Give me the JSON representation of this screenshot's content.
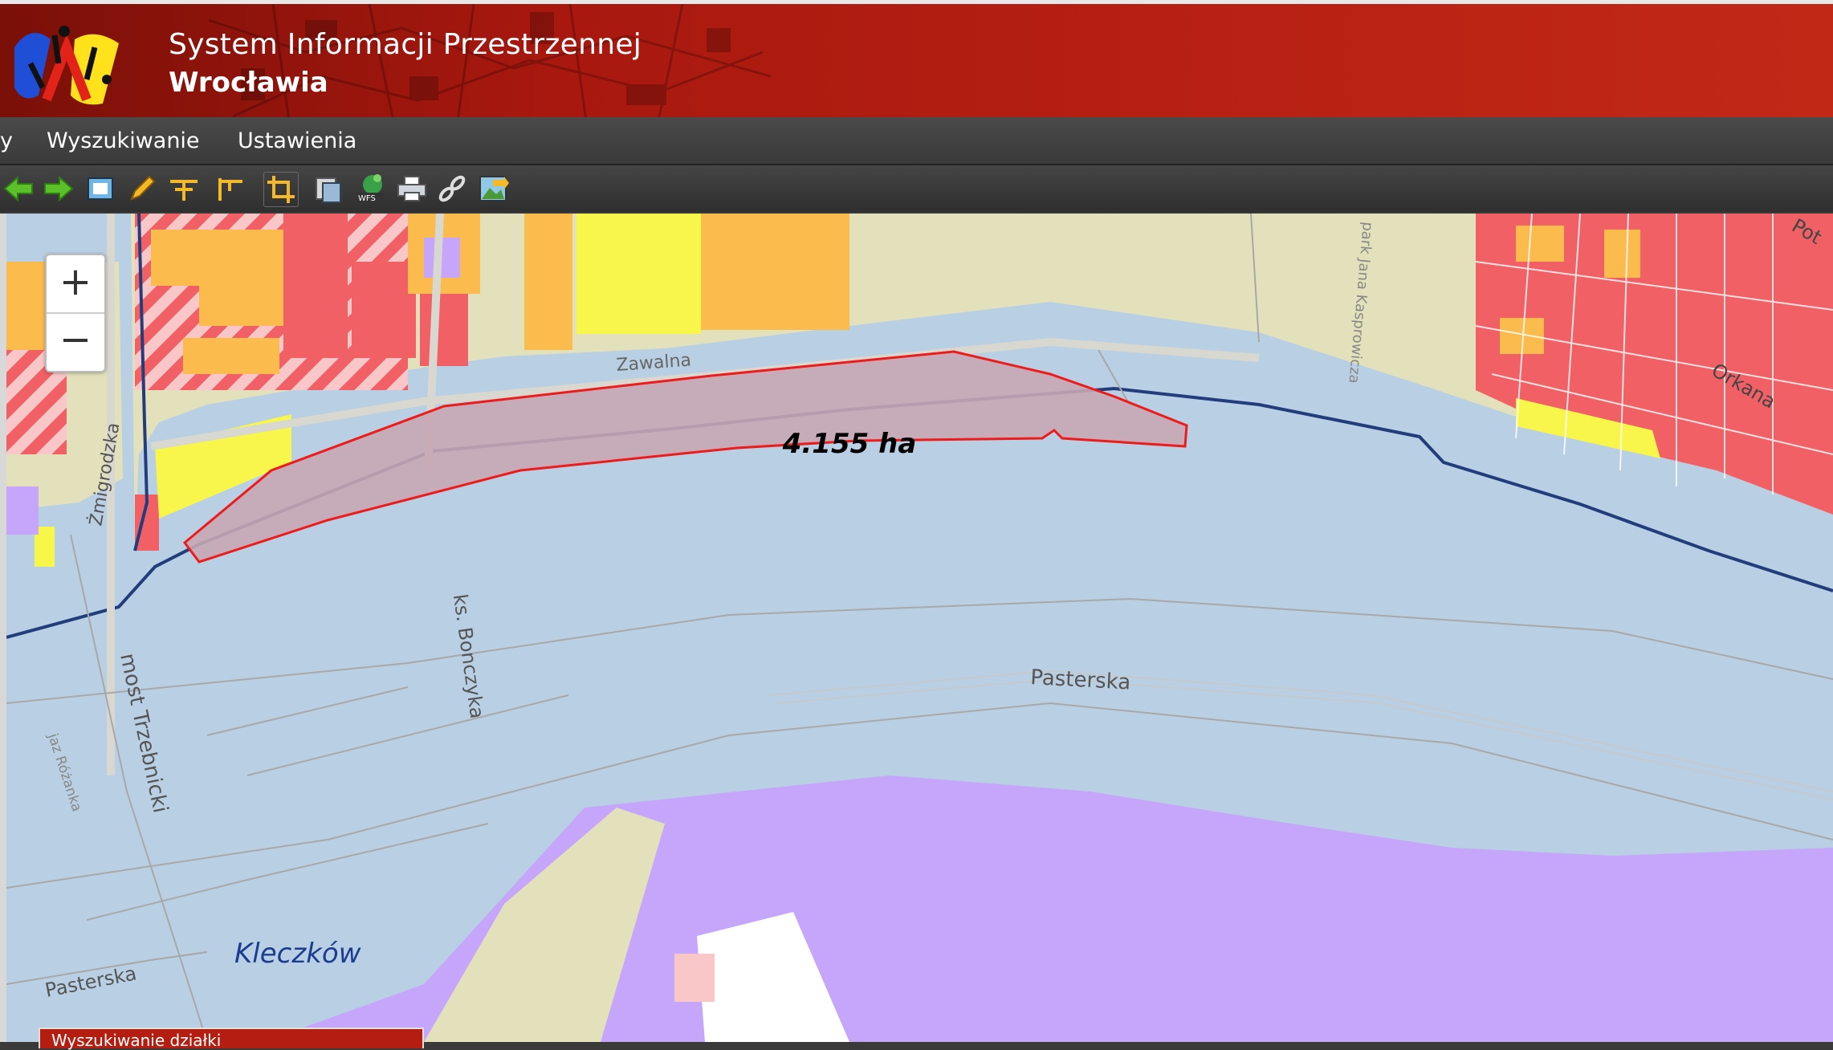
{
  "header": {
    "title_line1": "System Informacji Przestrzennej",
    "title_line2": "Wrocławia"
  },
  "menu": {
    "items": [
      {
        "label": "y"
      },
      {
        "label": "Wyszukiwanie"
      },
      {
        "label": "Ustawienia"
      }
    ]
  },
  "toolbar": {
    "tools": [
      "back-arrow-icon",
      "forward-arrow-icon",
      "full-extent-icon",
      "draw-pencil-icon",
      "measure-distance-icon",
      "measure-area-icon",
      "crop-icon",
      "layers-icon",
      "wfs-icon",
      "print-icon",
      "link-icon",
      "export-image-icon"
    ]
  },
  "map": {
    "zoom_in_label": "+",
    "zoom_out_label": "−",
    "area_label": "4.155 ha",
    "labels": {
      "street_zawalna": "Zawalna",
      "street_bonczyka": "ks. Bonczyka",
      "street_zmigrodzka": "Żmigrodzka",
      "bridge_trzebnicki": "most Trzebnicki",
      "street_pasterska_center": "Pasterska",
      "street_pasterska_left": "Pasterska",
      "park_kasprowicza": "park Jana Kasprowicza",
      "street_orkana": "Orkana",
      "street_pot": "Pot",
      "weir_rozanka": "jaz Różanka",
      "district_kleczkow": "Kleczków"
    },
    "colors": {
      "water": "#b9cfe3",
      "residential": "#f06064",
      "service": "#fbbb4d",
      "yellow": "#f8f64a",
      "green_beige": "#e2e1bb",
      "purple": "#c5a6fb",
      "selection_fill": "#c8a6b4",
      "selection_stroke": "#ee1b1b"
    }
  },
  "bottom_panel": {
    "title": "Wyszukiwanie działki"
  }
}
